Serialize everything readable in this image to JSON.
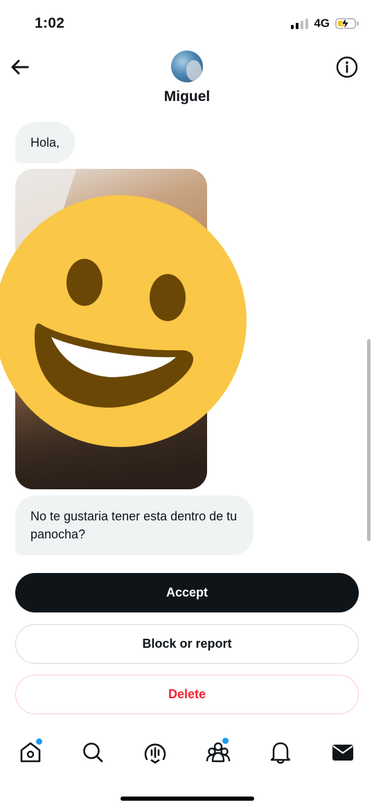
{
  "status": {
    "time": "1:02",
    "network": "4G",
    "battery_fraction": 0.45
  },
  "header": {
    "name": "Miguel"
  },
  "messages": [
    {
      "text": "Hola,"
    },
    {
      "text": "No te gustaria tener esta dentro de tu panocha?"
    }
  ],
  "actions": {
    "accept": "Accept",
    "block": "Block or report",
    "delete": "Delete"
  },
  "colors": {
    "accent": "#1d9bf0",
    "danger": "#f4212e",
    "bubble": "#eff3f4",
    "dark": "#0f1419"
  },
  "tabs": [
    {
      "icon": "home-icon",
      "badge": true
    },
    {
      "icon": "search-icon",
      "badge": false
    },
    {
      "icon": "spaces-icon",
      "badge": false
    },
    {
      "icon": "communities-icon",
      "badge": true
    },
    {
      "icon": "bell-icon",
      "badge": false
    },
    {
      "icon": "mail-icon",
      "badge": false
    }
  ]
}
